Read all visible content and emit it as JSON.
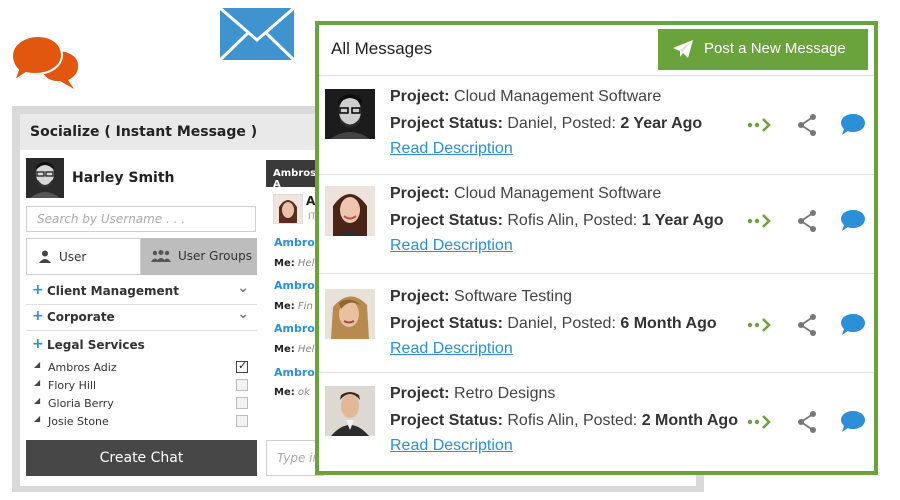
{
  "chat": {
    "title": "Socialize ( Instant Message )",
    "current_user": "Harley Smith",
    "search_placeholder": "Search by Username . . .",
    "tabs": [
      {
        "label": "User",
        "icon": "user-icon"
      },
      {
        "label": "User Groups",
        "icon": "users-icon"
      }
    ],
    "groups": [
      {
        "label": "Client Management"
      },
      {
        "label": "Corporate"
      },
      {
        "label": "Legal Services"
      }
    ],
    "members": [
      {
        "name": "Ambros Adiz",
        "checked": true
      },
      {
        "name": "Flory Hill",
        "checked": false
      },
      {
        "name": "Gloria Berry",
        "checked": false
      },
      {
        "name": "Josie Stone",
        "checked": false
      }
    ],
    "create_chat_label": "Create Chat",
    "conversation": {
      "header": "Ambros A",
      "contact_initial": "A",
      "contact_sub": "IT",
      "messages": [
        {
          "name": "Ambros",
          "me": "Me:",
          "text": "Hel"
        },
        {
          "name": "Ambros",
          "me": "Me:",
          "text": "Fin"
        },
        {
          "name": "Ambros",
          "me": "Me:",
          "text": "Hel"
        },
        {
          "name": "Ambros",
          "me": "Me:",
          "text": "ok"
        }
      ],
      "type_placeholder": "Type in"
    }
  },
  "messages_panel": {
    "title": "All Messages",
    "post_button": "Post a New Message",
    "project_label": "Project:",
    "status_label": "Project Status:",
    "posted_label": "Posted:",
    "read_link": "Read Description",
    "accent_color": "#6aa23b",
    "link_color": "#2d8fd5",
    "items": [
      {
        "project": "Cloud Management Software",
        "status": "Daniel,",
        "posted": "2 Year Ago",
        "avatar": "man-glasses-bw"
      },
      {
        "project": "Cloud Management Software",
        "status": "Rofis Alin,",
        "posted": "1 Year Ago",
        "avatar": "woman-smiling"
      },
      {
        "project": "Software Testing",
        "status": "Daniel,",
        "posted": "6 Month Ago",
        "avatar": "woman-blonde"
      },
      {
        "project": "Retro Designs",
        "status": "Rofis Alin,",
        "posted": "2 Month Ago",
        "avatar": "man-suit"
      }
    ]
  }
}
